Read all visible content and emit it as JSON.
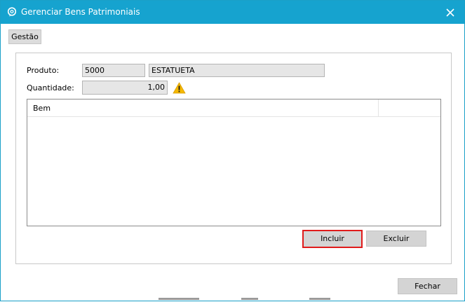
{
  "window": {
    "title": "Gerenciar Bens Patrimoniais",
    "close_glyph": "✕"
  },
  "tabs": [
    {
      "label": "Gestão"
    }
  ],
  "form": {
    "produto_label": "Produto:",
    "produto_code": "5000",
    "produto_name": "ESTATUETA",
    "quantidade_label": "Quantidade:",
    "quantidade_value": "1,00"
  },
  "grid": {
    "columns": [
      "Bem"
    ],
    "rows": []
  },
  "buttons": {
    "incluir": "Incluir",
    "excluir": "Excluir",
    "fechar": "Fechar"
  },
  "colors": {
    "titlebar": "#16a3cf",
    "highlight": "#e01b1b",
    "warning": "#f5b800"
  },
  "icons": {
    "app": "app-logo-icon",
    "warning": "warning-icon",
    "close": "close-icon"
  }
}
